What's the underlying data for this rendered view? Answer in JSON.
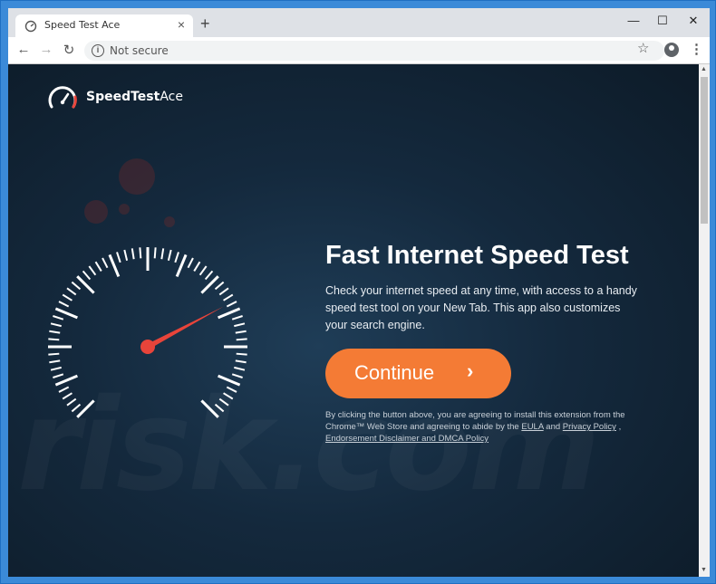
{
  "browser": {
    "tab_title": "Speed Test Ace",
    "new_tab": "+",
    "close_tab": "×",
    "address": "Not secure",
    "window_controls": {
      "minimize": "—",
      "maximize": "☐",
      "close": "✕"
    }
  },
  "page": {
    "logo_bold": "SpeedTest",
    "logo_light": "Ace",
    "headline": "Fast Internet Speed Test",
    "description": "Check your internet speed at any time, with access to a handy speed test tool on your New Tab. This app also customizes your search engine.",
    "continue_label": "Continue",
    "legal_prefix": "By clicking the button above, you are agreeing to install this extension from the Chrome™ Web Store and agreeing to abide by the",
    "legal_eula": "EULA",
    "legal_and": "and",
    "legal_privacy": "Privacy Policy",
    "legal_comma": ",",
    "legal_endorsement": "Endorsement Disclaimer and DMCA Policy",
    "watermark": "risk.com"
  },
  "colors": {
    "accent": "#f47b35",
    "needle": "#e8443a",
    "background": "#14293d"
  },
  "icons": [
    "speedometer-icon",
    "info-icon",
    "star-icon",
    "account-icon",
    "menu-icon",
    "back-icon",
    "forward-icon",
    "reload-icon",
    "chevron-right-icon"
  ]
}
